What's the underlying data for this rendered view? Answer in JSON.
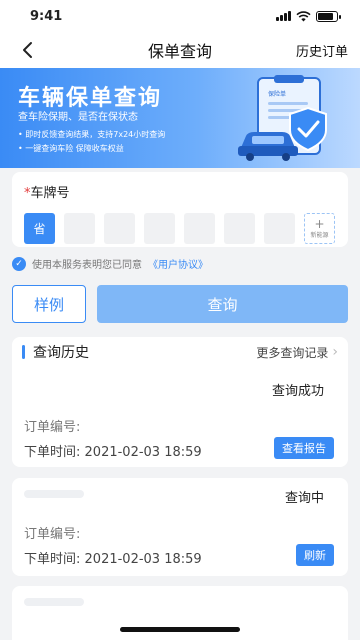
{
  "status_bar": {
    "time": "9:41"
  },
  "nav": {
    "title": "保单查询",
    "right_label": "历史订单"
  },
  "banner": {
    "title": "车辆保单查询",
    "subtitle": "查车险保期、是否在保状态",
    "points": [
      "即时反馈查询结果，支持7x24小时查询",
      "一键查询车险 保障收车权益"
    ],
    "art_label": "保险单"
  },
  "plate": {
    "required_mark": "*",
    "label": "车牌号",
    "province_label": "省",
    "new_energy_label": "新能源",
    "new_energy_plus": "+"
  },
  "agreement": {
    "text": "使用本服务表明您已同意",
    "link": "《用户协议》"
  },
  "buttons": {
    "sample": "样例",
    "query": "查询"
  },
  "history": {
    "title": "查询历史",
    "more": "更多查询记录",
    "orders": [
      {
        "status": "查询成功",
        "order_no_label": "订单编号:",
        "time_label": "下单时间:",
        "time": "2021-02-03 18:59",
        "action": "查看报告"
      },
      {
        "status": "查询中",
        "order_no_label": "订单编号:",
        "time_label": "下单时间:",
        "time": "2021-02-03 18:59",
        "action": "刷新"
      }
    ]
  },
  "colors": {
    "accent": "#3a8bf5",
    "query_button": "#7fb7f7",
    "required": "#e23b3b"
  },
  "battery_level": 0.85
}
